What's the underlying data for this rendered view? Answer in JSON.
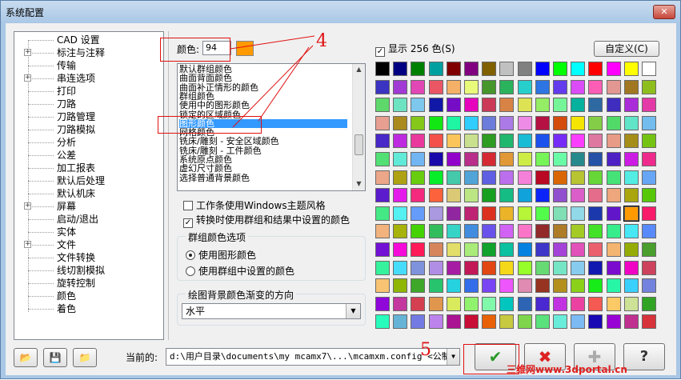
{
  "window": {
    "title": "系统配置",
    "close_label": "✕"
  },
  "tree": {
    "items": [
      {
        "label": "CAD 设置",
        "expandable": false
      },
      {
        "label": "标注与注释",
        "expandable": true
      },
      {
        "label": "传输",
        "expandable": false
      },
      {
        "label": "串连选项",
        "expandable": true
      },
      {
        "label": "打印",
        "expandable": false
      },
      {
        "label": "刀路",
        "expandable": false
      },
      {
        "label": "刀路管理",
        "expandable": false
      },
      {
        "label": "刀路模拟",
        "expandable": false
      },
      {
        "label": "分析",
        "expandable": false
      },
      {
        "label": "公差",
        "expandable": false
      },
      {
        "label": "加工报表",
        "expandable": false
      },
      {
        "label": "默认后处理",
        "expandable": false
      },
      {
        "label": "默认机床",
        "expandable": false
      },
      {
        "label": "屏幕",
        "expandable": true
      },
      {
        "label": "启动/退出",
        "expandable": false
      },
      {
        "label": "实体",
        "expandable": false
      },
      {
        "label": "文件",
        "expandable": true
      },
      {
        "label": "文件转换",
        "expandable": false
      },
      {
        "label": "线切割模拟",
        "expandable": false
      },
      {
        "label": "旋转控制",
        "expandable": false
      },
      {
        "label": "颜色",
        "expandable": false
      },
      {
        "label": "着色",
        "expandable": false
      }
    ]
  },
  "color_field": {
    "label": "颜色:",
    "value": "94",
    "swatch_color": "#ff9a00"
  },
  "color_list": {
    "items": [
      "默认群组颜色",
      "曲面背面颜色",
      "曲面补正情形的颜色",
      "群组颜色",
      "使用中的图形颜色",
      "锁定的区域颜色",
      "图形颜色",
      "网格颜色",
      "铣床/雕刻 - 安全区域颜色",
      "铣床/雕刻 - 工件颜色",
      "系统原点颜色",
      "虚幻尺寸颜色",
      "选择普通背景颜色"
    ],
    "selected_index": 6
  },
  "checkboxes": {
    "windows_theme": {
      "label": "工作条使用Windows主题风格",
      "checked": false
    },
    "use_group_colors": {
      "label": "转换时使用群组和结果中设置的颜色",
      "checked": true
    }
  },
  "group_color_options": {
    "title": "群组颜色选项",
    "options": [
      {
        "label": "使用图形颜色",
        "selected": true
      },
      {
        "label": "使用群组中设置的颜色",
        "selected": false
      }
    ]
  },
  "gradient": {
    "title": "绘图背景颜色渐变的方向",
    "value": "水平"
  },
  "palette": {
    "show256_label": "显示 256 色(S)",
    "show256_checked": true,
    "custom_label": "自定义(C)",
    "selected_index": 142
  },
  "bottom": {
    "current_label": "当前的:",
    "path": "d:\\用户目录\\documents\\my mcamx7\\...\\mcamxm.config <公制>",
    "ok_icon": "check-icon",
    "cancel_icon": "x-icon",
    "apply_icon": "plus-icon",
    "help_label": "?"
  },
  "annotations": {
    "four": "4",
    "five": "5"
  },
  "watermark": "三维网www.3dportal.cn",
  "colors": {
    "accent": "#3399ff",
    "annotation": "#e01010"
  }
}
